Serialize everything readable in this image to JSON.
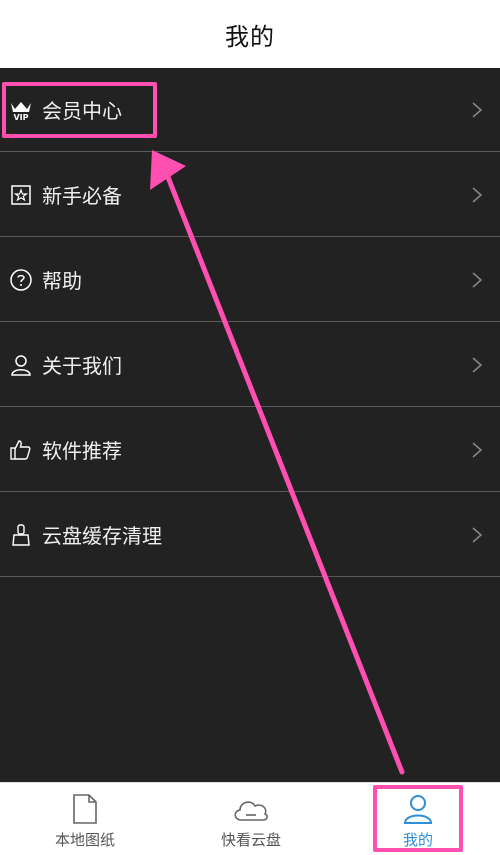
{
  "header": {
    "title": "我的"
  },
  "menu": {
    "items": [
      {
        "label": "会员中心",
        "icon": "vip-crown-icon"
      },
      {
        "label": "新手必备",
        "icon": "star-badge-icon"
      },
      {
        "label": "帮助",
        "icon": "help-circle-icon"
      },
      {
        "label": "关于我们",
        "icon": "user-outline-icon"
      },
      {
        "label": "软件推荐",
        "icon": "thumbs-up-icon"
      },
      {
        "label": "云盘缓存清理",
        "icon": "broom-icon"
      }
    ]
  },
  "tabbar": {
    "tabs": [
      {
        "label": "本地图纸",
        "icon": "document-icon"
      },
      {
        "label": "快看云盘",
        "icon": "cloud-icon"
      },
      {
        "label": "我的",
        "icon": "user-icon",
        "active": true
      }
    ]
  },
  "colors": {
    "accent": "#2f8fd8",
    "annotation": "#ff4fb0",
    "background": "#222222"
  }
}
